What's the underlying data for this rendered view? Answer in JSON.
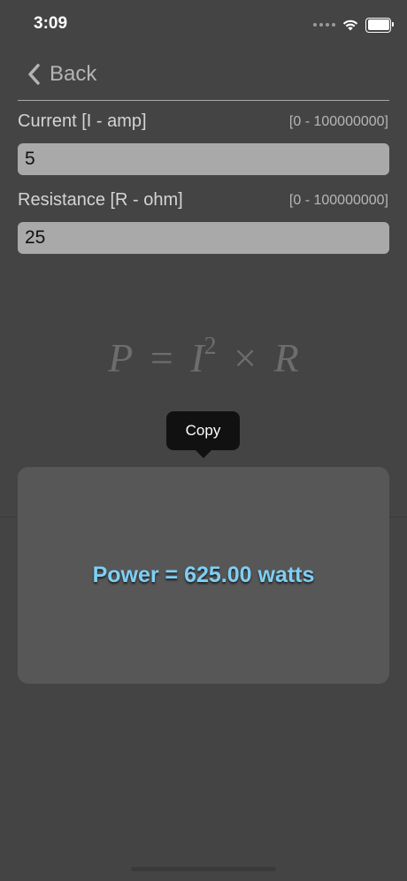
{
  "status_bar": {
    "time": "3:09",
    "icons": [
      "signal-dots-icon",
      "wifi-icon",
      "battery-icon"
    ]
  },
  "nav": {
    "back_label": "Back",
    "back_icon": "chevron-left-icon"
  },
  "fields": [
    {
      "label": "Current [I - amp]",
      "range": "[0 - 100000000]",
      "value": "5"
    },
    {
      "label": "Resistance [R - ohm]",
      "range": "[0 - 100000000]",
      "value": "25"
    }
  ],
  "formula": {
    "lhs": "P",
    "equals": "=",
    "var1": "I",
    "exponent": "2",
    "times": "×",
    "var2": "R"
  },
  "tooltip": {
    "label": "Copy"
  },
  "result": {
    "text": "Power = 625.00 watts"
  },
  "colors": {
    "background": "#444444",
    "input_bg": "#a9a9a9",
    "card_bg": "#575757",
    "result_text": "#7fcff4",
    "tooltip_bg": "#111111"
  }
}
